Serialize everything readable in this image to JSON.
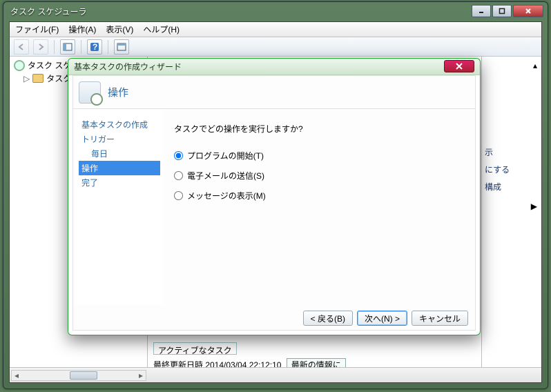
{
  "window": {
    "title": "タスク スケジューラ"
  },
  "menu": {
    "file": "ファイル(F)",
    "action": "操作(A)",
    "view": "表示(V)",
    "help": "ヘルプ(H)"
  },
  "tree": {
    "root": "タスク スケ",
    "sub": "タスク"
  },
  "actions_pane": {
    "item_show": "示",
    "item_enable": "にする",
    "item_config": "構成"
  },
  "center": {
    "status_label": "最終更新日時 2014/03/04 22:12:10",
    "refresh_btn": "最新の情報に",
    "active_tasks": "アクティブなタスク"
  },
  "dialog": {
    "title": "基本タスクの作成ウィザード",
    "heading": "操作",
    "steps": {
      "s1": "基本タスクの作成",
      "s2": "トリガー",
      "s2a": "毎日",
      "s3": "操作",
      "s4": "完了"
    },
    "question": "タスクでどの操作を実行しますか?",
    "opt1": "プログラムの開始(T)",
    "opt2": "電子メールの送信(S)",
    "opt3": "メッセージの表示(M)",
    "btn_back": "< 戻る(B)",
    "btn_next": "次へ(N) >",
    "btn_cancel": "キャンセル"
  }
}
